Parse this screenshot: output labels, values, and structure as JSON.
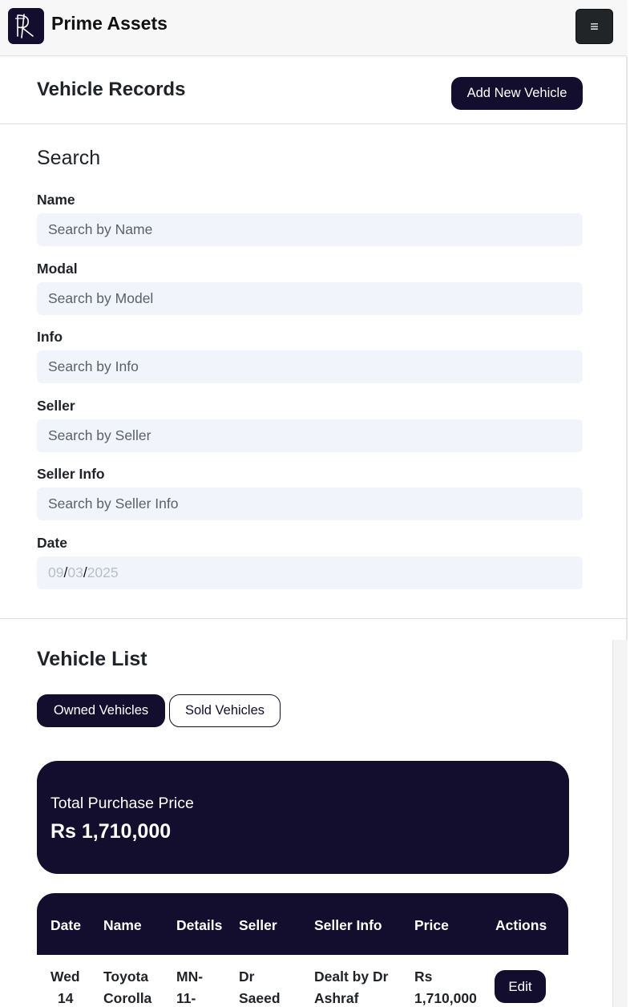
{
  "navbar": {
    "brand": "Prime Assets",
    "menu_icon": "hamburger-icon",
    "menu_glyph": "≡"
  },
  "header": {
    "title": "Vehicle Records",
    "add_button": "Add New Vehicle"
  },
  "search": {
    "title": "Search",
    "fields": [
      {
        "label": "Name",
        "placeholder": "Search by Name"
      },
      {
        "label": "Modal",
        "placeholder": "Search by Model"
      },
      {
        "label": "Info",
        "placeholder": "Search by Info"
      },
      {
        "label": "Seller",
        "placeholder": "Search by Seller"
      },
      {
        "label": "Seller Info",
        "placeholder": "Search by Seller Info"
      }
    ],
    "date": {
      "label": "Date",
      "month": "09",
      "day": "03",
      "year": "2025",
      "sep": "/"
    }
  },
  "list": {
    "title": "Vehicle List",
    "tabs": [
      {
        "label": "Owned Vehicles",
        "active": true
      },
      {
        "label": "Sold Vehicles",
        "active": false
      }
    ],
    "summary": {
      "label": "Total Purchase Price",
      "value": "Rs 1,710,000"
    },
    "table": {
      "headers": [
        "Date",
        "Name",
        "Details",
        "Seller",
        "Seller Info",
        "Price",
        "Actions"
      ],
      "rows": [
        {
          "date": [
            "Wed",
            "14"
          ],
          "name": [
            "Toyota",
            "Corolla"
          ],
          "details": [
            "MN-",
            "11-"
          ],
          "seller": [
            "Dr",
            "Saeed"
          ],
          "seller_info": [
            "Dealt by Dr",
            "Ashraf"
          ],
          "price": [
            "Rs",
            "1,710,000"
          ],
          "action": "Edit"
        }
      ]
    }
  },
  "colors": {
    "primary": "#130d2e",
    "input_bg": "#f1f5fb",
    "menu_button": "#222528"
  }
}
